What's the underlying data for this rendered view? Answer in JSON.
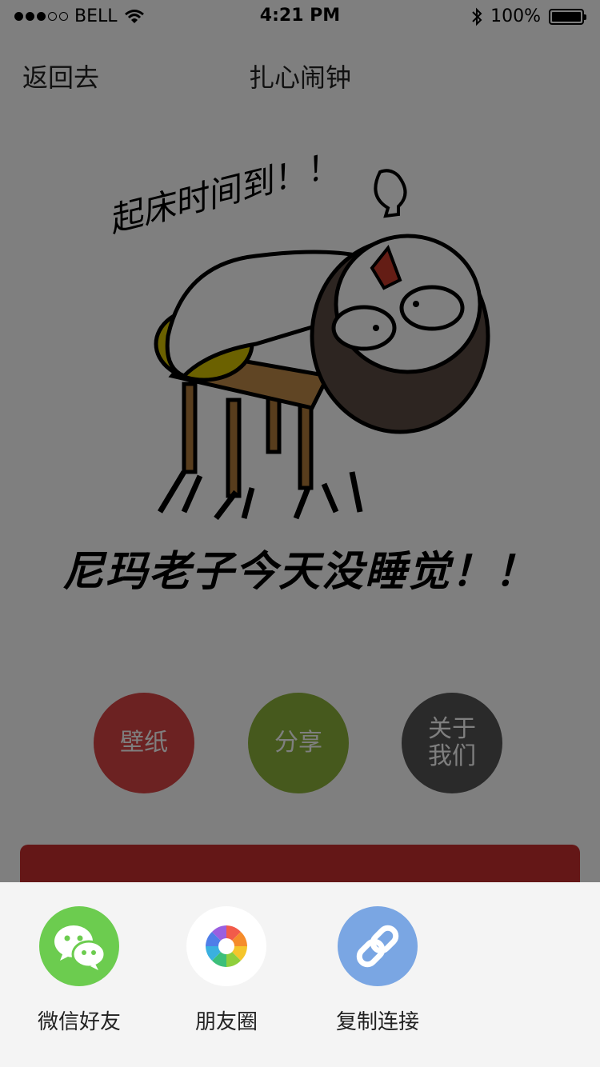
{
  "status_bar": {
    "carrier": "BELL",
    "time": "4:21 PM",
    "battery": "100%",
    "signal_bars_filled": 3,
    "signal_bars_total": 5
  },
  "nav": {
    "back_label": "返回去",
    "title": "扎心闹钟"
  },
  "illustration": {
    "handwritten_text": "起床时间到！！",
    "caption": "尼玛老子今天没睡觉！！"
  },
  "buttons": {
    "wallpaper_label": "壁纸",
    "share_label": "分享",
    "about_label_line1": "关于",
    "about_label_line2": "我们"
  },
  "share_sheet": {
    "items": [
      {
        "label": "微信好友",
        "icon": "wechat-icon"
      },
      {
        "label": "朋友圈",
        "icon": "moments-icon"
      },
      {
        "label": "复制连接",
        "icon": "link-icon"
      }
    ]
  },
  "colors": {
    "wallpaper": "#d94545",
    "share": "#8cb23a",
    "about": "#555555",
    "banner": "#c92e2e",
    "wechat": "#6ccc4f",
    "copy_link": "#7aa6e3"
  }
}
